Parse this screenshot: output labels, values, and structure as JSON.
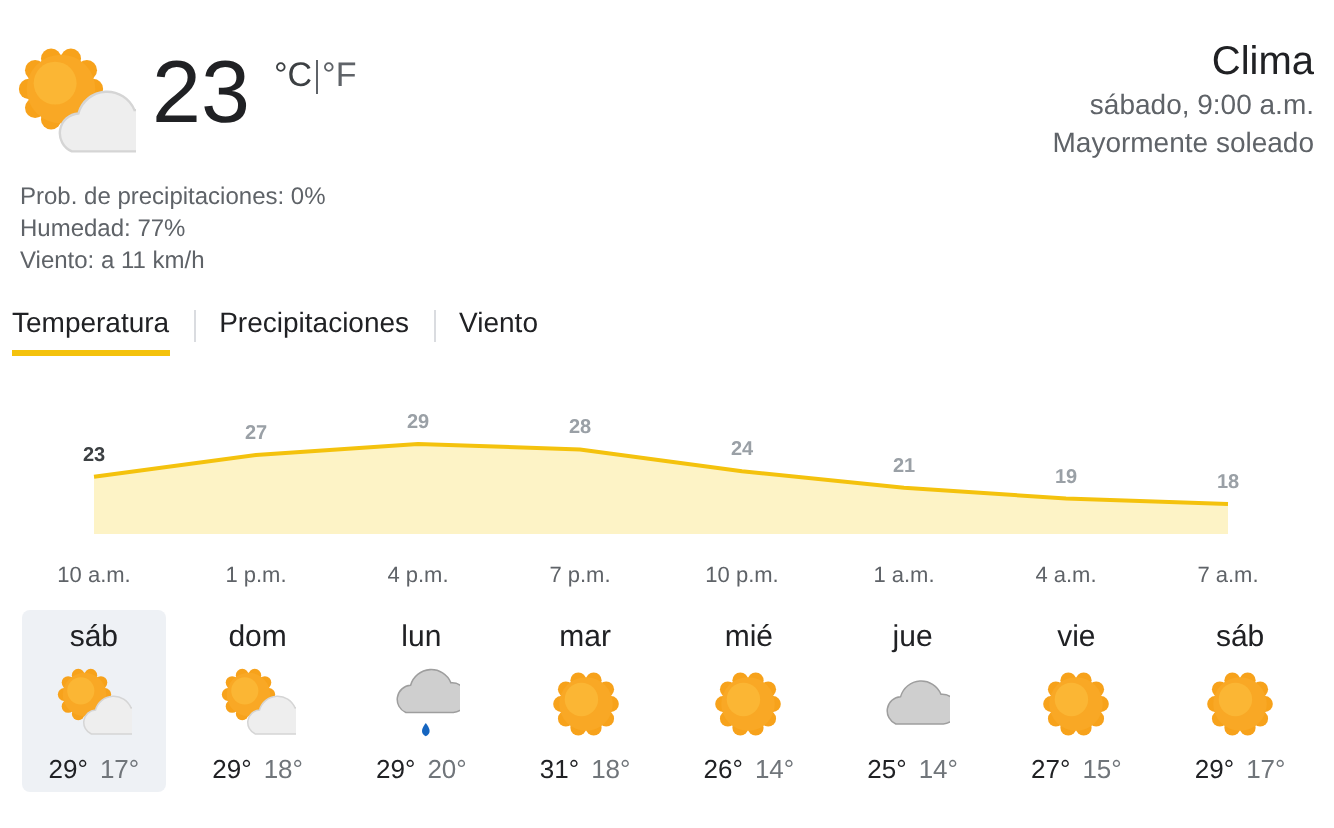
{
  "current": {
    "kind": "partly_cloudy",
    "temperature": "23",
    "units": [
      {
        "label": "°C",
        "selected": true
      },
      {
        "label": "°F",
        "selected": false
      }
    ],
    "details": [
      "Prob. de precipitaciones: 0%",
      "Humedad: 77%",
      "Viento: a 11 km/h"
    ]
  },
  "header": {
    "title": "Clima",
    "datetime": "sábado, 9:00 a.m.",
    "condition": "Mayormente soleado"
  },
  "tabs": [
    {
      "label": "Temperatura",
      "selected": true
    },
    {
      "label": "Precipitaciones",
      "selected": false
    },
    {
      "label": "Viento",
      "selected": false
    }
  ],
  "chart_data": {
    "type": "area",
    "categories": [
      "10 a.m.",
      "1 p.m.",
      "4 p.m.",
      "7 p.m.",
      "10 p.m.",
      "1 a.m.",
      "4 a.m.",
      "7 a.m."
    ],
    "series": [
      {
        "color": "#f4c20d",
        "values": [
          23,
          27,
          29,
          28,
          24,
          21,
          19,
          18
        ]
      }
    ],
    "data_labels": true
  },
  "days": [
    {
      "day": "sáb",
      "kind": "partly_cloudy",
      "high": "29°",
      "low": "17°",
      "selected": true
    },
    {
      "day": "dom",
      "kind": "partly_cloudy",
      "high": "29°",
      "low": "18°",
      "selected": false
    },
    {
      "day": "lun",
      "kind": "rain",
      "high": "29°",
      "low": "20°",
      "selected": false
    },
    {
      "day": "mar",
      "kind": "sunny",
      "high": "31°",
      "low": "18°",
      "selected": false
    },
    {
      "day": "mié",
      "kind": "sunny",
      "high": "26°",
      "low": "14°",
      "selected": false
    },
    {
      "day": "jue",
      "kind": "cloudy",
      "high": "25°",
      "low": "14°",
      "selected": false
    },
    {
      "day": "vie",
      "kind": "sunny",
      "high": "27°",
      "low": "15°",
      "selected": false
    },
    {
      "day": "sáb",
      "kind": "sunny",
      "high": "29°",
      "low": "17°",
      "selected": false
    }
  ]
}
